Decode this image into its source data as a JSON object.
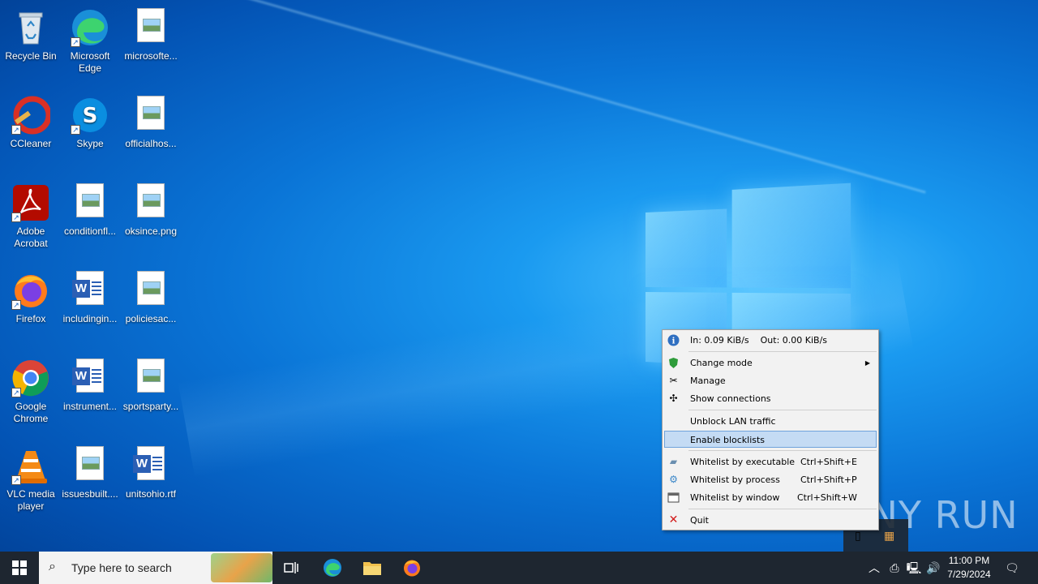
{
  "desktop": {
    "icons": [
      {
        "label": "Recycle Bin",
        "icon": "recycle-bin-icon"
      },
      {
        "label": "Microsoft Edge",
        "icon": "edge-icon"
      },
      {
        "label": "microsofte...",
        "icon": "image-file-icon"
      },
      {
        "label": "CCleaner",
        "icon": "ccleaner-icon"
      },
      {
        "label": "Skype",
        "icon": "skype-icon"
      },
      {
        "label": "officialhos...",
        "icon": "image-file-icon"
      },
      {
        "label": "Adobe Acrobat",
        "icon": "acrobat-icon"
      },
      {
        "label": "conditionfl...",
        "icon": "image-file-icon"
      },
      {
        "label": "oksince.png",
        "icon": "image-file-icon"
      },
      {
        "label": "Firefox",
        "icon": "firefox-icon"
      },
      {
        "label": "includingin...",
        "icon": "word-file-icon"
      },
      {
        "label": "policiesac...",
        "icon": "image-file-icon"
      },
      {
        "label": "Google Chrome",
        "icon": "chrome-icon"
      },
      {
        "label": "instrument...",
        "icon": "word-file-icon"
      },
      {
        "label": "sportsparty...",
        "icon": "image-file-icon"
      },
      {
        "label": "VLC media player",
        "icon": "vlc-icon"
      },
      {
        "label": "issuesbuilt....",
        "icon": "image-file-icon"
      },
      {
        "label": "unitsohio.rtf",
        "icon": "word-file-icon"
      }
    ]
  },
  "menu": {
    "traffic": "In: 0.09 KiB/s    Out: 0.00 KiB/s",
    "change_mode": "Change mode",
    "manage": "Manage",
    "show_connections": "Show connections",
    "unblock_lan": "Unblock LAN traffic",
    "enable_blocklists": "Enable blocklists",
    "whitelist_exe": "Whitelist by executable",
    "whitelist_exe_sc": "Ctrl+Shift+E",
    "whitelist_proc": "Whitelist by process",
    "whitelist_proc_sc": "Ctrl+Shift+P",
    "whitelist_win": "Whitelist by window",
    "whitelist_win_sc": "Ctrl+Shift+W",
    "quit": "Quit"
  },
  "taskbar": {
    "search_placeholder": "Type here to search",
    "time": "11:00 PM",
    "date": "7/29/2024"
  },
  "watermark": "ANY RUN"
}
